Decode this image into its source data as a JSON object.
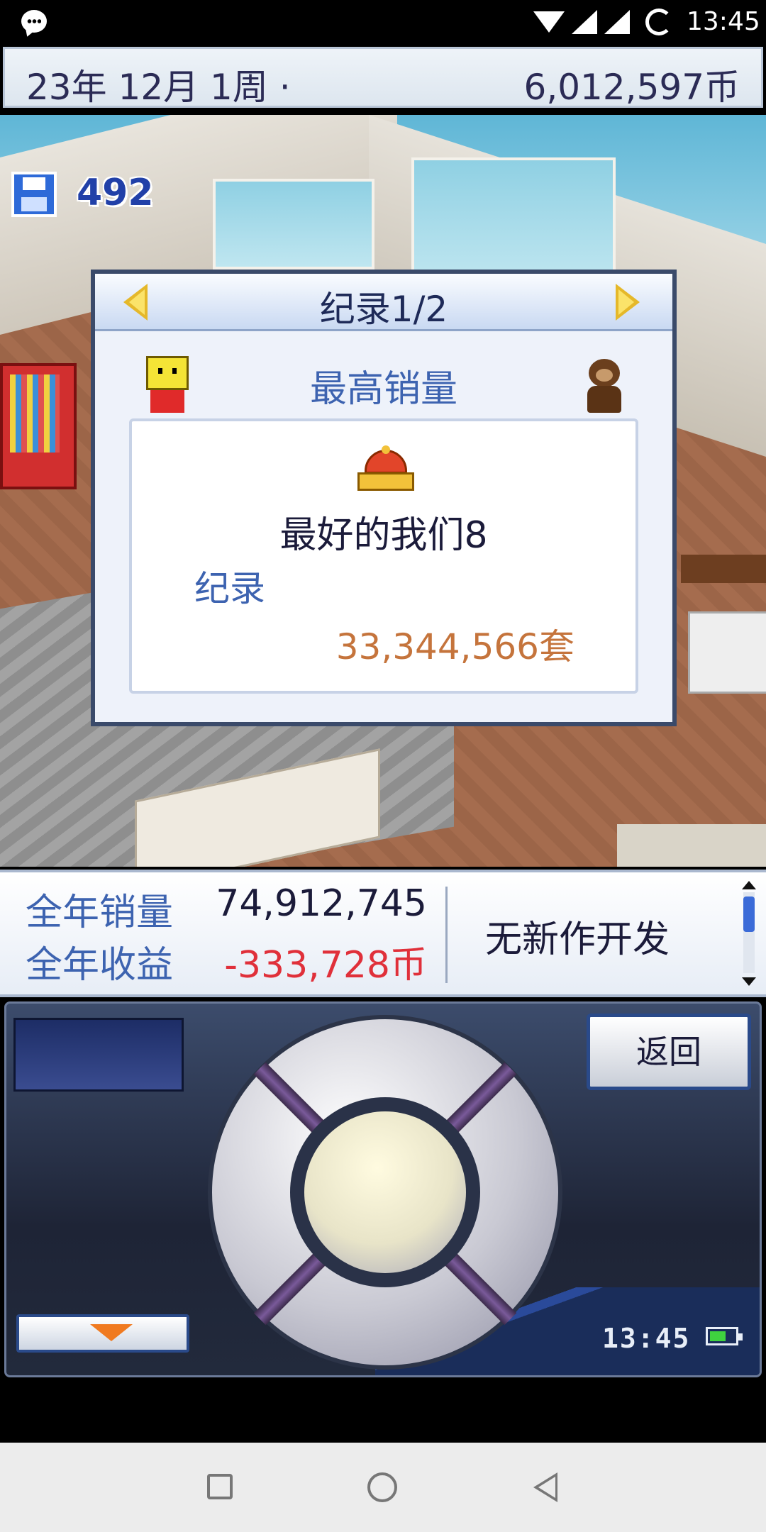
{
  "status_bar": {
    "time": "13:45",
    "icons": [
      "message-icon",
      "wifi-icon",
      "signal-icon",
      "signal-icon",
      "sync-icon"
    ]
  },
  "top_bar": {
    "date": "23年 12月 1周 ·",
    "money": "6,012,597币"
  },
  "save": {
    "icon": "floppy-disk-icon",
    "count": "492"
  },
  "record_dialog": {
    "title": "纪录1/2",
    "category": "最高销量",
    "icon": "crown-icon",
    "game_name": "最好的我们8",
    "label": "纪录",
    "value": "33,344,566套"
  },
  "stats": {
    "annual_sales_label": "全年销量",
    "annual_sales_value": "74,912,745",
    "annual_income_label": "全年收益",
    "annual_income_value": "-333,728币",
    "dev_status": "无新作开发"
  },
  "controller": {
    "back_label": "返回",
    "time": "13:45"
  },
  "colors": {
    "accent_blue": "#3d63b0",
    "negative_red": "#e0303a",
    "record_orange": "#c5743c"
  }
}
